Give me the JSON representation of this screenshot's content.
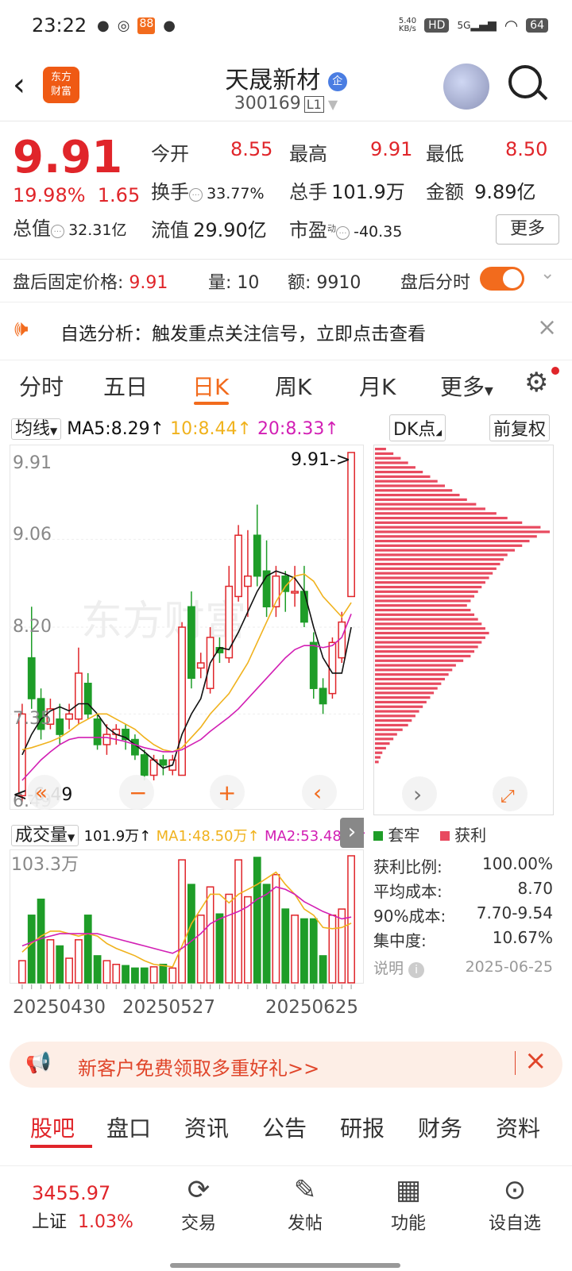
{
  "status": {
    "time": "23:22",
    "net_speed": "5.40\nKB/s",
    "network": "5G",
    "battery": "64"
  },
  "header": {
    "name": "天晟新材",
    "badge": "企",
    "code": "300169",
    "level": "L1",
    "logo_text": "东方\n财富"
  },
  "quote": {
    "price": "9.91",
    "change_pct": "19.98%",
    "change": "1.65",
    "open_label": "今开",
    "open": "8.55",
    "high_label": "最高",
    "high": "9.91",
    "low_label": "最低",
    "low": "8.50",
    "turnover_label": "换手",
    "turnover": "33.77%",
    "volume_label": "总手",
    "volume": "101.9万",
    "amount_label": "金额",
    "amount": "9.89亿",
    "mktcap_label": "总值",
    "mktcap": "32.31亿",
    "float_label": "流值",
    "float": "29.90亿",
    "pe_label": "市盈",
    "pe_sup": "动",
    "pe": "-40.35",
    "more": "更多"
  },
  "afterhours": {
    "label": "盘后固定价格:",
    "price": "9.91",
    "vol_label": "量:",
    "vol": "10",
    "amt_label": "额:",
    "amt": "9910",
    "timeshare": "盘后分时"
  },
  "notice": {
    "text": "自选分析：触发重点关注信号，立即点击查看"
  },
  "tabs": [
    "分时",
    "五日",
    "日K",
    "周K",
    "月K",
    "更多"
  ],
  "ma_bar": {
    "sel": "均线",
    "ma5": "MA5:8.29↑",
    "ma10": "10:8.44↑",
    "ma20": "20:8.33↑",
    "dk": "DK点",
    "adj": "前复权"
  },
  "colors": {
    "up": "#e0252a",
    "down": "#1e9d28",
    "ma5": "#111111",
    "ma10": "#f0b21d",
    "ma20": "#d21fb4",
    "accent": "#f26b1d"
  },
  "kline_labels": {
    "y_top": "9.91",
    "y2": "9.06",
    "y3": "8.20",
    "y4": "7.35",
    "y_bot": "6.49",
    "max_tag": "9.91->",
    "min_tag": "<-6.49"
  },
  "chart_data": [
    {
      "type": "candlestick",
      "title": "",
      "ylim": [
        6.49,
        9.91
      ],
      "y_ticks": [
        "9.91",
        "9.06",
        "8.20",
        "7.35",
        "6.49"
      ],
      "candles": [
        {
          "o": 6.55,
          "c": 7.35,
          "h": 7.45,
          "l": 6.49
        },
        {
          "o": 7.9,
          "c": 7.5,
          "h": 8.4,
          "l": 7.4
        },
        {
          "o": 7.5,
          "c": 7.2,
          "h": 7.6,
          "l": 7.1
        },
        {
          "o": 7.25,
          "c": 7.4,
          "h": 7.5,
          "l": 7.2
        },
        {
          "o": 7.3,
          "c": 7.15,
          "h": 7.45,
          "l": 7.05
        },
        {
          "o": 7.3,
          "c": 7.35,
          "h": 7.45,
          "l": 7.2
        },
        {
          "o": 7.3,
          "c": 7.75,
          "h": 8.0,
          "l": 7.25
        },
        {
          "o": 7.65,
          "c": 7.35,
          "h": 7.75,
          "l": 7.3
        },
        {
          "o": 7.3,
          "c": 7.05,
          "h": 7.35,
          "l": 7.0
        },
        {
          "o": 7.05,
          "c": 7.15,
          "h": 7.25,
          "l": 6.95
        },
        {
          "o": 7.15,
          "c": 7.2,
          "h": 7.25,
          "l": 7.05
        },
        {
          "o": 7.2,
          "c": 7.1,
          "h": 7.25,
          "l": 7.0
        },
        {
          "o": 7.1,
          "c": 6.95,
          "h": 7.15,
          "l": 6.9
        },
        {
          "o": 6.95,
          "c": 6.75,
          "h": 7.0,
          "l": 6.7
        },
        {
          "o": 6.75,
          "c": 6.9,
          "h": 6.95,
          "l": 6.7
        },
        {
          "o": 6.9,
          "c": 6.85,
          "h": 6.95,
          "l": 6.75
        },
        {
          "o": 6.8,
          "c": 6.9,
          "h": 6.95,
          "l": 6.75
        },
        {
          "o": 6.75,
          "c": 8.2,
          "h": 8.25,
          "l": 6.75
        },
        {
          "o": 8.4,
          "c": 7.7,
          "h": 8.55,
          "l": 7.6
        },
        {
          "o": 7.8,
          "c": 7.85,
          "h": 7.95,
          "l": 7.7
        },
        {
          "o": 7.6,
          "c": 8.1,
          "h": 8.2,
          "l": 7.55
        },
        {
          "o": 8.0,
          "c": 7.95,
          "h": 8.1,
          "l": 7.85
        },
        {
          "o": 7.9,
          "c": 8.6,
          "h": 8.8,
          "l": 7.85
        },
        {
          "o": 8.5,
          "c": 9.1,
          "h": 9.2,
          "l": 8.45
        },
        {
          "o": 8.6,
          "c": 8.7,
          "h": 9.15,
          "l": 8.3
        },
        {
          "o": 9.1,
          "c": 8.7,
          "h": 9.4,
          "l": 8.6
        },
        {
          "o": 8.75,
          "c": 8.4,
          "h": 9.05,
          "l": 8.3
        },
        {
          "o": 8.4,
          "c": 8.7,
          "h": 8.8,
          "l": 8.3
        },
        {
          "o": 8.7,
          "c": 8.55,
          "h": 8.75,
          "l": 8.35
        },
        {
          "o": 8.55,
          "c": 8.55,
          "h": 8.8,
          "l": 8.4
        },
        {
          "o": 8.55,
          "c": 8.25,
          "h": 8.8,
          "l": 8.2
        },
        {
          "o": 8.05,
          "c": 7.6,
          "h": 8.15,
          "l": 7.5
        },
        {
          "o": 7.6,
          "c": 7.45,
          "h": 7.7,
          "l": 7.35
        },
        {
          "o": 7.55,
          "c": 8.05,
          "h": 8.1,
          "l": 7.5
        },
        {
          "o": 7.9,
          "c": 8.25,
          "h": 8.35,
          "l": 7.85
        },
        {
          "o": 8.5,
          "c": 9.91,
          "h": 9.91,
          "l": 8.5
        }
      ],
      "ma5": [
        6.95,
        7.15,
        7.3,
        7.38,
        7.42,
        7.38,
        7.45,
        7.45,
        7.35,
        7.22,
        7.15,
        7.12,
        7.05,
        6.98,
        6.9,
        6.82,
        6.85,
        7.15,
        7.35,
        7.5,
        7.85,
        8.0,
        7.98,
        8.15,
        8.35,
        8.55,
        8.7,
        8.75,
        8.72,
        8.68,
        8.55,
        8.2,
        7.9,
        7.75,
        7.75,
        8.2
      ],
      "ma10": [
        7.0,
        7.02,
        7.05,
        7.08,
        7.12,
        7.18,
        7.25,
        7.3,
        7.35,
        7.35,
        7.3,
        7.25,
        7.2,
        7.12,
        7.05,
        7.0,
        6.98,
        7.02,
        7.12,
        7.22,
        7.35,
        7.45,
        7.55,
        7.7,
        7.85,
        8.05,
        8.25,
        8.45,
        8.6,
        8.7,
        8.72,
        8.65,
        8.5,
        8.4,
        8.3,
        8.44
      ],
      "ma20": [
        6.7,
        6.8,
        6.9,
        6.98,
        7.05,
        7.1,
        7.12,
        7.12,
        7.12,
        7.12,
        7.1,
        7.08,
        7.05,
        7.02,
        7.0,
        6.98,
        6.98,
        7.0,
        7.05,
        7.1,
        7.18,
        7.25,
        7.32,
        7.4,
        7.5,
        7.6,
        7.7,
        7.8,
        7.9,
        7.98,
        8.02,
        8.02,
        8.0,
        8.02,
        8.1,
        8.33
      ]
    },
    {
      "type": "bar",
      "title": "",
      "ylim": [
        0,
        103.3
      ],
      "y_label_top": "103.3万",
      "x_ticks": [
        "20250430",
        "20250527",
        "20250625"
      ],
      "volumes": [
        18,
        55,
        68,
        35,
        30,
        20,
        35,
        55,
        22,
        18,
        15,
        14,
        12,
        12,
        13,
        15,
        12,
        100,
        80,
        55,
        78,
        56,
        72,
        100,
        70,
        102,
        80,
        88,
        60,
        55,
        52,
        52,
        22,
        55,
        60,
        103.3
      ],
      "ma1": [
        25,
        32,
        38,
        42,
        42,
        40,
        38,
        40,
        38,
        32,
        28,
        25,
        22,
        18,
        15,
        14,
        13,
        30,
        48,
        60,
        72,
        72,
        65,
        72,
        76,
        80,
        85,
        90,
        80,
        72,
        60,
        55,
        45,
        44,
        45,
        48.5
      ],
      "ma2": [
        30,
        33,
        36,
        38,
        40,
        40,
        40,
        40,
        40,
        38,
        36,
        34,
        32,
        30,
        28,
        26,
        24,
        28,
        34,
        40,
        48,
        52,
        55,
        58,
        62,
        68,
        72,
        78,
        76,
        72,
        66,
        62,
        58,
        55,
        52,
        53.48
      ]
    },
    {
      "type": "bar",
      "title": "",
      "orientation": "horizontal",
      "series": [
        {
          "name": "套牢",
          "values": []
        },
        {
          "name": "获利",
          "values": [
            2,
            3,
            4,
            6,
            8,
            10,
            12,
            15,
            18,
            20,
            22,
            24,
            26,
            28,
            30,
            32,
            34,
            36,
            38,
            40,
            42,
            44,
            48,
            52,
            54,
            56,
            58,
            60,
            62,
            60,
            58,
            56,
            54,
            52,
            50,
            52,
            54,
            56,
            58,
            60,
            62,
            64,
            66,
            68,
            70,
            72,
            76,
            80,
            84,
            88,
            95,
            90,
            80,
            72,
            66,
            60,
            55,
            50,
            46,
            42,
            38,
            34,
            30,
            26,
            22,
            18,
            14,
            10,
            6
          ]
        }
      ]
    }
  ],
  "volume_bar": {
    "sel": "成交量",
    "vol": "101.9万↑",
    "ma1": "MA1:48.50万↑",
    "ma2": "MA2:53.48万↑",
    "top": "103.3万",
    "dates": [
      "20250430",
      "20250527",
      "20250625"
    ]
  },
  "chips": {
    "legend_loss": "套牢",
    "legend_profit": "获利",
    "rows": [
      {
        "label": "获利比例:",
        "value": "100.00%"
      },
      {
        "label": "平均成本:",
        "value": "8.70"
      },
      {
        "label": "90%成本:",
        "value": "7.70-9.54"
      },
      {
        "label": "集中度:",
        "value": "10.67%"
      }
    ],
    "note": "说明",
    "date": "2025-06-25"
  },
  "banner": {
    "text": "新客户免费领取多重好礼>>"
  },
  "info_tabs": [
    "股吧",
    "盘口",
    "资讯",
    "公告",
    "研报",
    "财务",
    "资料"
  ],
  "bottom": {
    "index_value": "3455.97",
    "index_name": "上证",
    "index_pct": "1.03%",
    "items": [
      "交易",
      "发帖",
      "功能",
      "设自选"
    ]
  }
}
